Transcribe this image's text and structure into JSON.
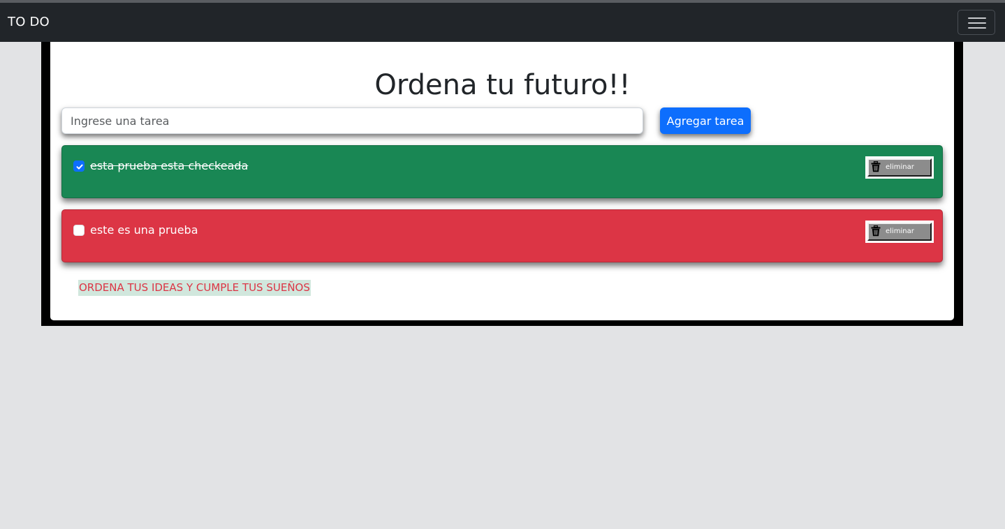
{
  "navbar": {
    "brand": "TO DO",
    "toggler_icon": "hamburger-menu-icon"
  },
  "main": {
    "title": "Ordena tu futuro!!",
    "task_input": {
      "value": "",
      "placeholder": "Ingrese una tarea"
    },
    "add_button_label": "Agregar tarea",
    "tasks": [
      {
        "text": "esta prueba esta checkeada",
        "checked": true,
        "color": "#198754",
        "delete_label": "eliminar",
        "delete_icon": "trash-icon"
      },
      {
        "text": "este es una prueba",
        "checked": false,
        "color": "#dc3545",
        "delete_label": "eliminar",
        "delete_icon": "trash-icon"
      }
    ],
    "footer_note": "ORDENA TUS IDEAS Y CUMPLE TUS SUEÑOS"
  },
  "colors": {
    "navbar_bg": "#212529",
    "primary": "#0d6efd",
    "success": "#198754",
    "danger": "#dc3545",
    "page_bg": "#e2e3e5"
  }
}
